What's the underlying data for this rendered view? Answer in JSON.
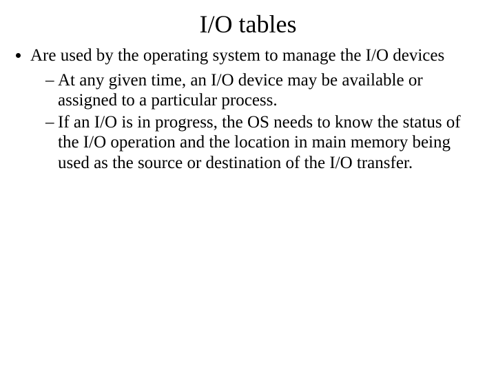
{
  "title": "I/O tables",
  "bullets": {
    "level1": [
      {
        "text": "Are used by the operating system to manage the I/O devices",
        "sub": [
          "At any given time, an I/O device may be available or assigned to a particular process.",
          "If an I/O is in progress, the OS needs to know the status of the I/O operation and the location in main memory being used as the source or destination of the I/O transfer."
        ]
      }
    ]
  }
}
